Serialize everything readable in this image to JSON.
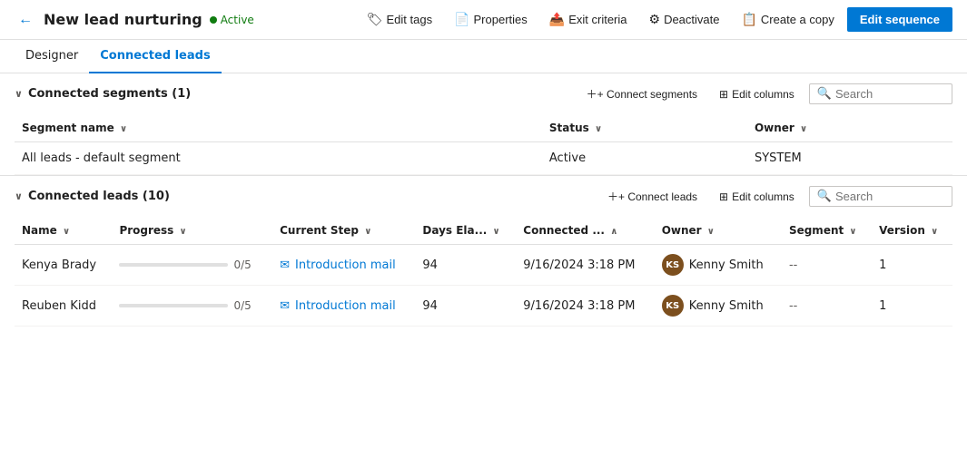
{
  "topBar": {
    "backIcon": "←",
    "title": "New lead nurturing",
    "statusLabel": "Active",
    "actions": [
      {
        "id": "edit-tags",
        "icon": "🏷",
        "label": "Edit tags"
      },
      {
        "id": "properties",
        "icon": "📄",
        "label": "Properties"
      },
      {
        "id": "exit-criteria",
        "icon": "📤",
        "label": "Exit criteria"
      },
      {
        "id": "deactivate",
        "icon": "⚙",
        "label": "Deactivate"
      },
      {
        "id": "create-copy",
        "icon": "📋",
        "label": "Create a copy"
      }
    ],
    "primaryButton": "Edit sequence"
  },
  "tabs": [
    {
      "id": "designer",
      "label": "Designer",
      "active": false
    },
    {
      "id": "connected-leads",
      "label": "Connected leads",
      "active": true
    }
  ],
  "segmentsSection": {
    "title": "Connected segments",
    "count": 1,
    "connectButton": "+ Connect segments",
    "editColumnsButton": "Edit columns",
    "searchPlaceholder": "Search",
    "columns": [
      {
        "label": "Segment name",
        "sort": true
      },
      {
        "label": "Status",
        "sort": true
      },
      {
        "label": "Owner",
        "sort": true
      }
    ],
    "rows": [
      {
        "segmentName": "All leads - default segment",
        "status": "Active",
        "owner": "SYSTEM"
      }
    ]
  },
  "leadsSection": {
    "title": "Connected leads",
    "count": 10,
    "connectButton": "+ Connect leads",
    "editColumnsButton": "Edit columns",
    "searchPlaceholder": "Search",
    "columns": [
      {
        "label": "Name",
        "sort": true
      },
      {
        "label": "Progress",
        "sort": true
      },
      {
        "label": "Current Step",
        "sort": true
      },
      {
        "label": "Days Ela...",
        "sort": true
      },
      {
        "label": "Connected ...",
        "sort": true,
        "sortDir": "desc"
      },
      {
        "label": "Owner",
        "sort": true
      },
      {
        "label": "Segment",
        "sort": true
      },
      {
        "label": "Version",
        "sort": true
      }
    ],
    "rows": [
      {
        "name": "Kenya Brady",
        "progressValue": 0,
        "progressLabel": "0/5",
        "currentStep": "Introduction mail",
        "daysElapsed": "94",
        "connectedDate": "9/16/2024 3:18 PM",
        "ownerInitials": "KS",
        "ownerName": "Kenny Smith",
        "segment": "--",
        "version": "1"
      },
      {
        "name": "Reuben Kidd",
        "progressValue": 0,
        "progressLabel": "0/5",
        "currentStep": "Introduction mail",
        "daysElapsed": "94",
        "connectedDate": "9/16/2024 3:18 PM",
        "ownerInitials": "KS",
        "ownerName": "Kenny Smith",
        "segment": "--",
        "version": "1"
      }
    ]
  }
}
